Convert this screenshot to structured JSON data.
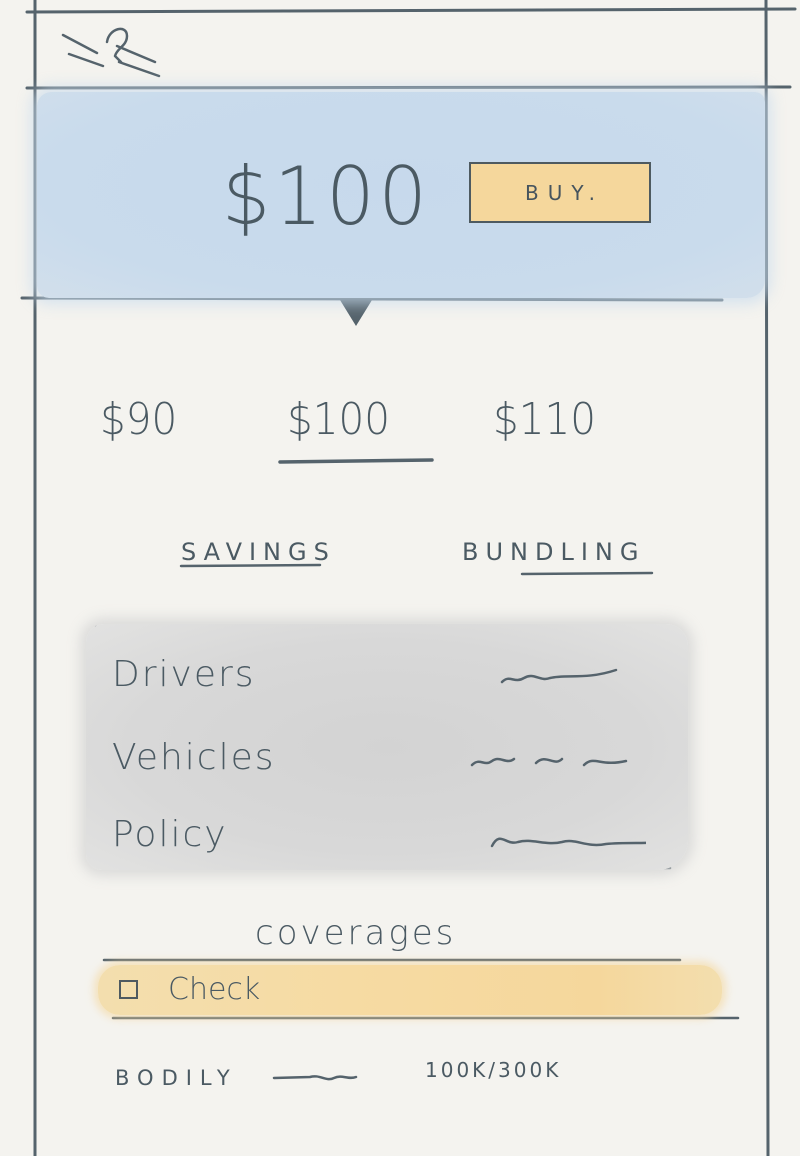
{
  "header": {
    "menu_icon": "menu-icon"
  },
  "price_header": {
    "amount": "$100",
    "buy_label": "BUY."
  },
  "tiers": [
    {
      "label": "$90",
      "selected": false
    },
    {
      "label": "$100",
      "selected": true
    },
    {
      "label": "$110",
      "selected": false
    }
  ],
  "tabs": {
    "savings": "SAVINGS",
    "bundling": "BUNDLING"
  },
  "details": {
    "rows": [
      {
        "label": "Drivers"
      },
      {
        "label": "Vehicles"
      },
      {
        "label": "Policy"
      }
    ]
  },
  "coverages": {
    "title": "coverages",
    "check_label": "Check",
    "bodily_label": "BODILY",
    "bodily_value": "100K/300K"
  },
  "colors": {
    "header_blue": "#c8daec",
    "accent_yellow": "#f5d79c",
    "panel_gray": "#d6d6d6",
    "ink": "#55636c",
    "paper": "#f4f3ef"
  }
}
